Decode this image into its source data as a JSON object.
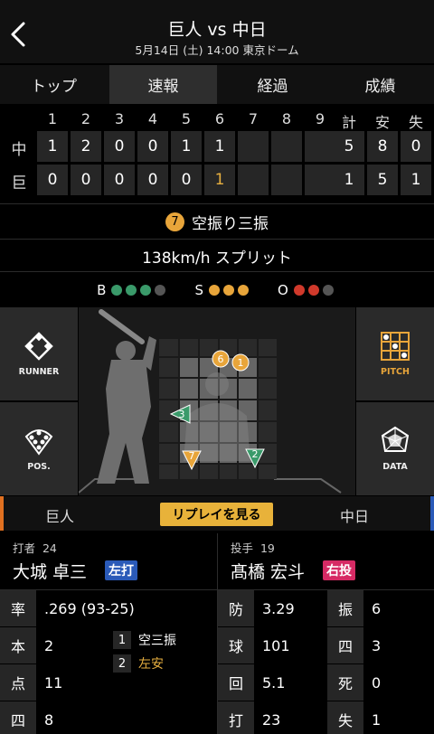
{
  "header": {
    "title": "巨人 vs 中日",
    "subtitle": "5月14日 (土) 14:00 東京ドーム"
  },
  "tabs": [
    {
      "label": "トップ",
      "active": false
    },
    {
      "label": "速報",
      "active": true
    },
    {
      "label": "経過",
      "active": false
    },
    {
      "label": "成績",
      "active": false
    }
  ],
  "scoreboard": {
    "innings": [
      "1",
      "2",
      "3",
      "4",
      "5",
      "6",
      "7",
      "8",
      "9"
    ],
    "totals_headers": [
      "計",
      "安",
      "失"
    ],
    "rows": [
      {
        "team": "中",
        "innings": [
          "1",
          "2",
          "0",
          "0",
          "1",
          "1",
          "",
          "",
          ""
        ],
        "totals": [
          "5",
          "8",
          "0"
        ]
      },
      {
        "team": "巨",
        "innings": [
          "0",
          "0",
          "0",
          "0",
          "0",
          "1",
          "",
          "",
          ""
        ],
        "totals": [
          "1",
          "5",
          "1"
        ]
      }
    ],
    "highlight": {
      "row": 1,
      "inning": 5
    }
  },
  "play": {
    "badge": "7",
    "result": "空振り三振",
    "speed": "138km/h スプリット"
  },
  "count": {
    "b_label": "B",
    "s_label": "S",
    "o_label": "O",
    "balls": [
      "#3a9a6a",
      "#3a9a6a",
      "#3a9a6a",
      "#555555"
    ],
    "strikes": [
      "#e8a53a",
      "#e8a53a",
      "#e8a53a"
    ],
    "outs": [
      "#d0392b",
      "#d0392b",
      "#555555"
    ]
  },
  "side_buttons": {
    "runner": "RUNNER",
    "pos": "POS.",
    "pitch": "PITCH",
    "data": "DATA"
  },
  "pitches": [
    {
      "label": "6",
      "shape": "circle",
      "color": "#e8a53a"
    },
    {
      "label": "1",
      "shape": "circle",
      "color": "#e8a53a"
    },
    {
      "label": "3",
      "shape": "triangle-left",
      "color": "#3a9a6a"
    },
    {
      "label": "7",
      "shape": "triangle-down",
      "color": "#e8a53a"
    },
    {
      "label": "2",
      "shape": "triangle-down",
      "color": "#3a9a6a"
    }
  ],
  "teambar": {
    "home": "巨人",
    "away": "中日",
    "replay": "リプレイを見る"
  },
  "batter": {
    "role": "打者",
    "number": "24",
    "name": "大城 卓三",
    "hand": "左打",
    "hand_color": "#2a5ab8"
  },
  "pitcher": {
    "role": "投手",
    "number": "19",
    "name": "髙橋 宏斗",
    "hand": "右投",
    "hand_color": "#d62a64"
  },
  "batter_stats": [
    {
      "key": "率",
      "value": ".269 (93-25)"
    },
    {
      "key": "本",
      "value": "2"
    },
    {
      "key": "点",
      "value": "11"
    },
    {
      "key": "四",
      "value": "8"
    }
  ],
  "at_bat_history": [
    {
      "num": "1",
      "text": "空三振",
      "color": "#ffffff"
    },
    {
      "num": "2",
      "text": "左安",
      "color": "#e8b040"
    }
  ],
  "pitcher_stats": [
    {
      "key": "防",
      "value": "3.29",
      "key2": "振",
      "value2": "6"
    },
    {
      "key": "球",
      "value": "101",
      "key2": "四",
      "value2": "3"
    },
    {
      "key": "回",
      "value": "5.1",
      "key2": "死",
      "value2": "0"
    },
    {
      "key": "打",
      "value": "23",
      "key2": "失",
      "value2": "1"
    }
  ]
}
